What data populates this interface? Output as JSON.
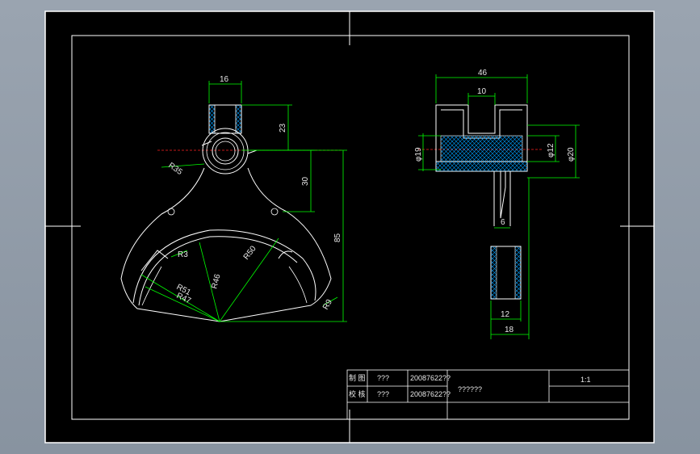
{
  "drawing": {
    "front_view": {
      "dims": {
        "width_16": "16",
        "height_23": "23",
        "radius_r35": "R35",
        "height_30": "30",
        "height_85": "85",
        "radius_r3": "R3",
        "radius_r50": "R50",
        "radius_r46": "R46",
        "radius_r51": "R51",
        "radius_r47": "R47",
        "radius_r9": "R9"
      }
    },
    "side_view": {
      "dims": {
        "width_46": "46",
        "width_10": "10",
        "dia_19": "φ19",
        "dia_12": "φ12",
        "dia_20": "φ20",
        "width_6": "6",
        "width_12": "12",
        "width_18": "18"
      }
    },
    "title_block": {
      "row1_label": "制 图",
      "row1_name": "???",
      "row1_date": "20087622??",
      "row2_label": "校 核",
      "row2_name": "???",
      "row2_date": "20087622??",
      "part_name": "??????",
      "scale": "1:1"
    }
  },
  "colors": {
    "background": "#000000",
    "outline": "#ffffff",
    "dimension": "#00ff00",
    "centerline": "#ff2020",
    "hatch": "#00a0ff",
    "window": "#8f99a5"
  }
}
